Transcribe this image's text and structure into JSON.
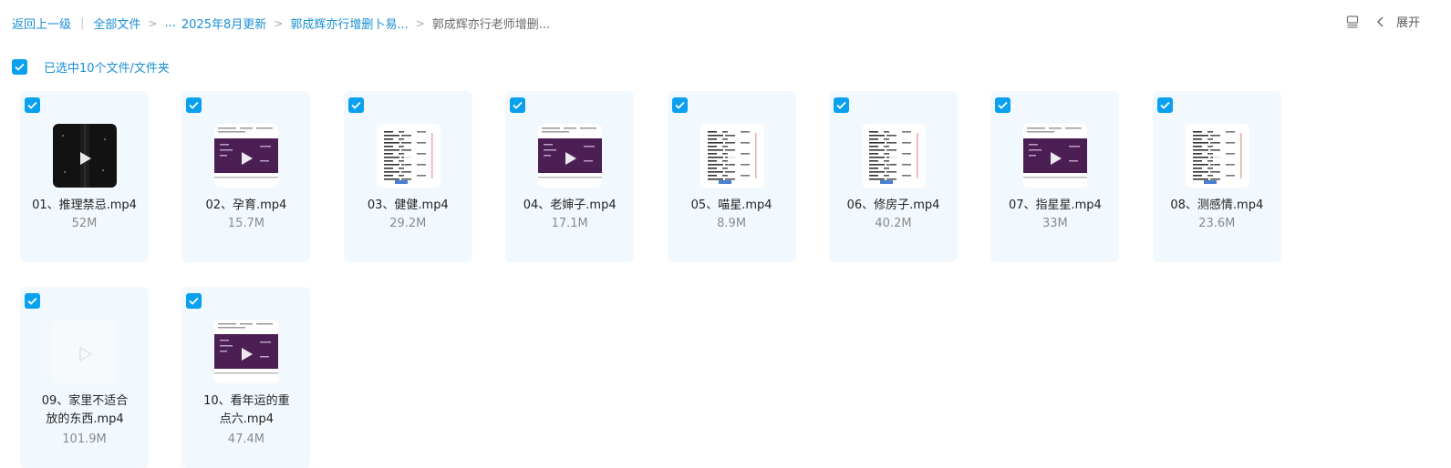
{
  "breadcrumb": {
    "back": "返回上一级",
    "all_files": "全部文件",
    "ellipsis": "...",
    "folder1": "2025年8月更新",
    "folder2": "郭成辉亦行增删卜易...",
    "current": "郭成辉亦行老师增删..."
  },
  "toolbar": {
    "layout_icon": "list-layout-icon",
    "expand_label": "展开"
  },
  "selection": {
    "label": "已选中10个文件/文件夹"
  },
  "colors": {
    "accent": "#0aa0f0",
    "link": "#1a8fd6",
    "card_bg": "#f2f9fe",
    "video_purple": "#3d1a48"
  },
  "files": [
    {
      "name": "01、推理禁忌.mp4",
      "size": "52M",
      "thumb": "dark"
    },
    {
      "name": "02、孕育.mp4",
      "size": "15.7M",
      "thumb": "purple"
    },
    {
      "name": "03、健健.mp4",
      "size": "29.2M",
      "thumb": "doc"
    },
    {
      "name": "04、老婶子.mp4",
      "size": "17.1M",
      "thumb": "purple"
    },
    {
      "name": "05、喵星.mp4",
      "size": "8.9M",
      "thumb": "doc"
    },
    {
      "name": "06、修房子.mp4",
      "size": "40.2M",
      "thumb": "doc"
    },
    {
      "name": "07、指星星.mp4",
      "size": "33M",
      "thumb": "purple"
    },
    {
      "name": "08、测感情.mp4",
      "size": "23.6M",
      "thumb": "doc"
    },
    {
      "name": "09、家里不适合放的东西.mp4",
      "size": "101.9M",
      "thumb": "blank"
    },
    {
      "name": "10、看年运的重点六.mp4",
      "size": "47.4M",
      "thumb": "purple"
    }
  ]
}
